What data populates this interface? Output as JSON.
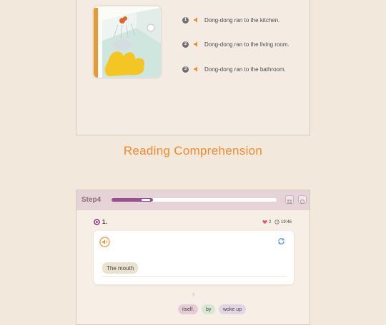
{
  "colors": {
    "accent": "#f08a2c",
    "progress": "#9a4f91",
    "header": "#e6d3d8"
  },
  "top_panel": {
    "choices": [
      {
        "num": "1",
        "text": "Dong-dong ran to the kitchen."
      },
      {
        "num": "2",
        "text": "Dong-dong ran to the living room."
      },
      {
        "num": "3",
        "text": "Dong-dong ran to the bathroom."
      }
    ]
  },
  "section": {
    "title": "Reading Comprehension"
  },
  "step": {
    "label": "Step4",
    "progress": 0.25,
    "question_number": "1.",
    "hearts": "2",
    "timer": "19:46",
    "answer_chip": "The mouth",
    "hint_mark": "?",
    "word_chips": [
      "itself.",
      "by",
      "woke up"
    ],
    "icons": [
      "speaker-icon",
      "refresh-icon",
      "grid-icon",
      "settings-icon",
      "heart-icon",
      "clock-icon"
    ]
  }
}
